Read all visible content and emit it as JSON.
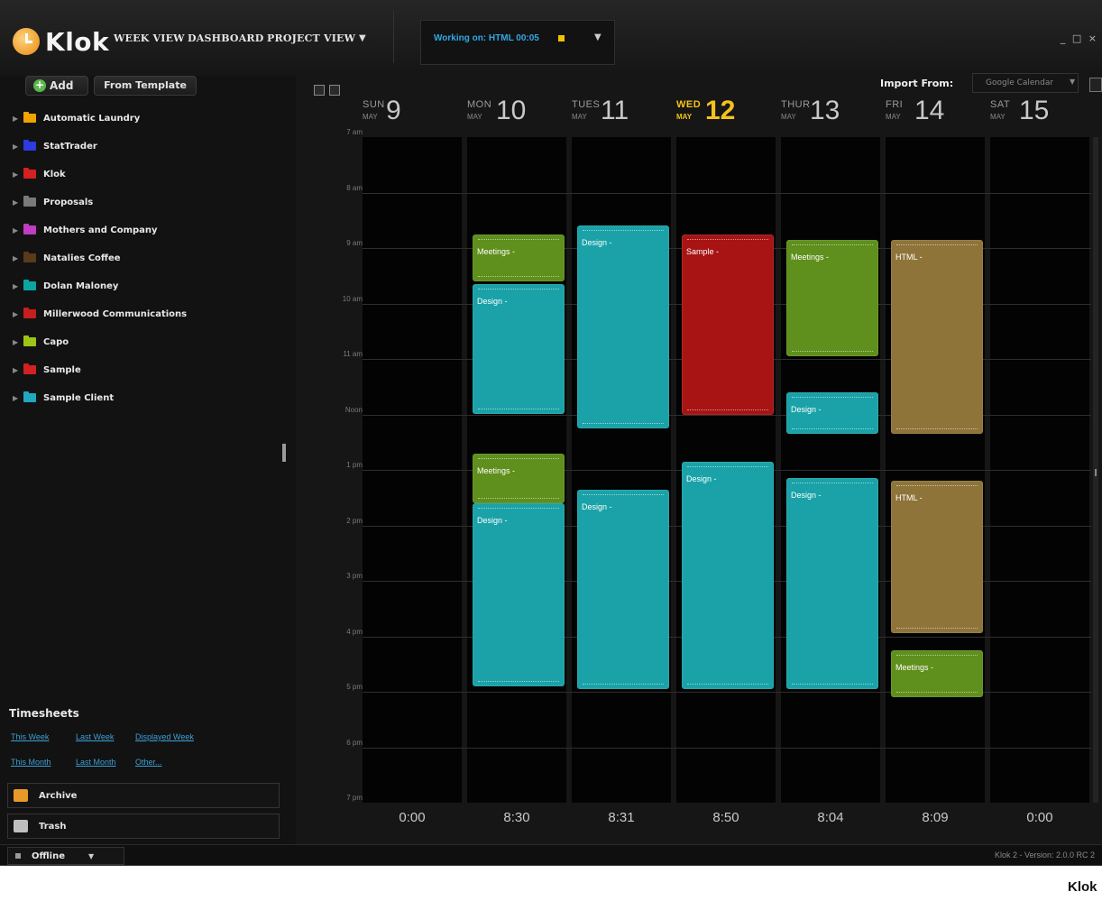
{
  "app": {
    "name": "Klok",
    "nav": [
      "WEEK VIEW",
      "DASHBOARD",
      "PROJECT VIEW"
    ],
    "working_on": "Working on: HTML 00:05",
    "window_controls": "_ □ ×"
  },
  "sidebar": {
    "add_label": "Add",
    "template_label": "From Template",
    "projects": [
      {
        "label": "Automatic Laundry",
        "color": "#f0a400"
      },
      {
        "label": "StatTrader",
        "color": "#2d3be0"
      },
      {
        "label": "Klok",
        "color": "#d42020"
      },
      {
        "label": "Proposals",
        "color": "#7a7a7a"
      },
      {
        "label": "Mothers and Company",
        "color": "#c03cc0"
      },
      {
        "label": "Natalies Coffee",
        "color": "#5a3a1a"
      },
      {
        "label": "Dolan Maloney",
        "color": "#0aa6a0"
      },
      {
        "label": "Millerwood Communications",
        "color": "#c81e1e"
      },
      {
        "label": "Capo",
        "color": "#9cc414"
      },
      {
        "label": "Sample",
        "color": "#d42020"
      },
      {
        "label": "Sample Client",
        "color": "#20a8c0"
      }
    ],
    "timesheets": {
      "title": "Timesheets",
      "links": [
        "This Week",
        "Last Week",
        "Displayed Week",
        "This Month",
        "Last Month",
        "Other..."
      ]
    },
    "archive_label": "Archive",
    "trash_label": "Trash"
  },
  "status": {
    "offline_label": "Offline",
    "version": "Klok 2 - Version: 2.0.0 RC 2"
  },
  "calendar": {
    "import_label": "Import From:",
    "import_source": "Google Calendar",
    "hours": [
      "7 am",
      "8 am",
      "9 am",
      "10 am",
      "11 am",
      "Noon",
      "1 pm",
      "2 pm",
      "3 pm",
      "4 pm",
      "5 pm",
      "6 pm",
      "7 pm"
    ],
    "days": [
      {
        "name": "SUN",
        "month": "MAY",
        "num": "9",
        "total": "0:00",
        "today": false
      },
      {
        "name": "MON",
        "month": "MAY",
        "num": "10",
        "total": "8:30",
        "today": false
      },
      {
        "name": "TUES",
        "month": "MAY",
        "num": "11",
        "total": "8:31",
        "today": false
      },
      {
        "name": "WED",
        "month": "MAY",
        "num": "12",
        "total": "8:50",
        "today": true
      },
      {
        "name": "THUR",
        "month": "MAY",
        "num": "13",
        "total": "8:04",
        "today": false
      },
      {
        "name": "FRI",
        "month": "MAY",
        "num": "14",
        "total": "8:09",
        "today": false
      },
      {
        "name": "SAT",
        "month": "MAY",
        "num": "15",
        "total": "0:00",
        "today": false
      }
    ],
    "colors": {
      "meetings": "#5f8f1c",
      "design": "#1aa2a8",
      "sample": "#a81414",
      "html": "#8e7439"
    },
    "events": [
      {
        "day": 1,
        "label": "Meetings -",
        "kind": "meetings",
        "start": 8.75,
        "end": 9.6
      },
      {
        "day": 1,
        "label": "Design -",
        "kind": "design",
        "start": 9.65,
        "end": 12.0
      },
      {
        "day": 1,
        "label": "Meetings -",
        "kind": "meetings",
        "start": 12.7,
        "end": 13.6
      },
      {
        "day": 1,
        "label": "Design -",
        "kind": "design",
        "start": 13.6,
        "end": 16.9
      },
      {
        "day": 2,
        "label": "Design -",
        "kind": "design",
        "start": 8.6,
        "end": 12.25
      },
      {
        "day": 2,
        "label": "Design -",
        "kind": "design",
        "start": 13.35,
        "end": 16.95
      },
      {
        "day": 3,
        "label": "Sample -",
        "kind": "sample",
        "start": 8.75,
        "end": 12.0
      },
      {
        "day": 3,
        "label": "Design -",
        "kind": "design",
        "start": 12.85,
        "end": 16.95
      },
      {
        "day": 4,
        "label": "Meetings -",
        "kind": "meetings",
        "start": 8.85,
        "end": 10.95
      },
      {
        "day": 4,
        "label": "Design -",
        "kind": "design",
        "start": 11.6,
        "end": 12.35
      },
      {
        "day": 4,
        "label": "Design -",
        "kind": "design",
        "start": 13.15,
        "end": 16.95
      },
      {
        "day": 5,
        "label": "HTML -",
        "kind": "html",
        "start": 8.85,
        "end": 12.35
      },
      {
        "day": 5,
        "label": "HTML -",
        "kind": "html",
        "start": 13.2,
        "end": 15.95
      },
      {
        "day": 5,
        "label": "Meetings -",
        "kind": "meetings",
        "start": 16.25,
        "end": 17.1
      }
    ]
  },
  "caption": "Klok"
}
